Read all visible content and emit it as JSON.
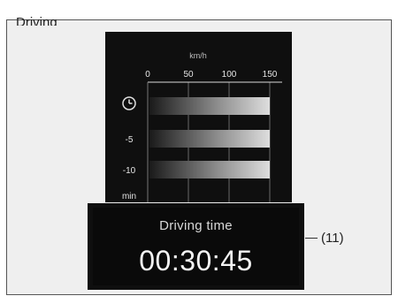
{
  "heading": "Driving",
  "speed_chart": {
    "unit": "km/h",
    "ticks": [
      "0",
      "50",
      "100",
      "150"
    ],
    "rows": [
      {
        "label": "",
        "icon": "clock-icon",
        "value_kmh": 150
      },
      {
        "label": "-5",
        "value_kmh": 150
      },
      {
        "label": "-10",
        "value_kmh": 150
      }
    ],
    "axis_unit": "min"
  },
  "chart_data": {
    "type": "bar",
    "categories": [
      "now",
      "-5",
      "-10"
    ],
    "values": [
      150,
      150,
      150
    ],
    "xlim": [
      0,
      150
    ],
    "xlabel": "km/h",
    "ylabel": "min"
  },
  "driving_time": {
    "label": "Driving time",
    "value": "00:30:45"
  },
  "callout": "(11)"
}
